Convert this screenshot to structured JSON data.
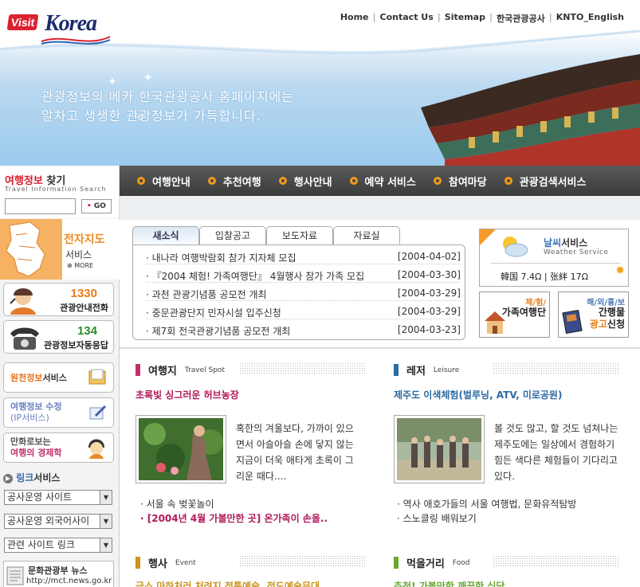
{
  "header": {
    "logo_visit": "Visit",
    "logo_korea": "Korea",
    "top_links": [
      "Home",
      "Contact Us",
      "Sitemap",
      "한국관광공사",
      "KNTO_English"
    ],
    "headline_line1": "관광정보의 메카 한국관광공사 홈페이지에는",
    "headline_line2": "알차고 생생한 관광정보가 가득합니다."
  },
  "nav": {
    "items": [
      "여행안내",
      "추천여행",
      "행사안내",
      "예약 서비스",
      "참여마당",
      "관광검색서비스"
    ]
  },
  "search": {
    "title_red": "여행정보",
    "title_black": " 찾기",
    "subtitle": "Travel Information Search",
    "input_value": "",
    "go_label": "GO"
  },
  "sidebar": {
    "emap_title": "전자지도",
    "emap_sub": "서비스",
    "emap_more": "MORE",
    "phone1_num": "1330",
    "phone1_label": "관광안내전화",
    "phone2_num": "134",
    "phone2_label": "관광정보자동응답",
    "svc1_a": "원천정보",
    "svc1_b": "서비스",
    "svc2_a": "여행정보 수정",
    "svc2_b": "(IP서비스)",
    "svc3_a": "만화로보는",
    "svc3_b": "여행의 경제학",
    "link_title_a": "링크",
    "link_title_b": "서비스",
    "selects": [
      "공사운영 사이트",
      "공사운영 외국어사이",
      "관련 사이트 링크"
    ],
    "mct_title": "문화관광부  뉴스",
    "mct_url": "http://mct.news.go.kr"
  },
  "news": {
    "tabs": [
      "새소식",
      "입찰공고",
      "보도자료",
      "자료실"
    ],
    "rows": [
      {
        "title": "·  내나라 여행박람회 참가 지자체 모집",
        "date": "[2004-04-02]"
      },
      {
        "title": "·  『2004 체험! 가족여행단』 4월행사 참가 가족 모집",
        "date": "[2004-03-30]"
      },
      {
        "title": "·  과천 관광기념품 공모전 개최",
        "date": "[2004-03-29]"
      },
      {
        "title": "·  중문관광단지 민자시설 입주신청",
        "date": "[2004-03-29]"
      },
      {
        "title": "·  제7회 전국관광기념품 공모전 개최",
        "date": "[2004-03-23]"
      }
    ]
  },
  "weather": {
    "title_a": "날씨",
    "title_b": "서비스",
    "subtitle": "Weather Service",
    "reading": "韓国 7.4Ω  | 张絆 17Ω"
  },
  "promos": {
    "family_top": "체/험/",
    "family_main": "가족여행단",
    "ad_top": "해/외/홍/보",
    "ad_main_a": "간행물",
    "ad_main_b_orange": "광고",
    "ad_main_c": "신청"
  },
  "sections": {
    "travel": {
      "title": "여행지",
      "en": "Travel Spot",
      "subtitle": "초록빛 싱그러운 허브농장",
      "text": "혹한의 겨울보다, 가까이 있으면서 아슬아슬 손에 닿지 않는 지금이 더욱 애타게 초록이 그리운 때다....",
      "items": [
        "·  서울 속 벚꽃놀이",
        "·  [2004년 4월 가볼만한 곳] 온가족이 손을.."
      ]
    },
    "leisure": {
      "title": "레저",
      "en": "Leisure",
      "subtitle": "제주도 이색체험(벌루닝, ATV, 미로공원)",
      "text": "볼 것도 많고, 할 것도 넘쳐나는 제주도에는 일상에서 경험하기 힘든 색다른 체험들이 기다리고 있다.",
      "items": [
        "·  역사 애호가들의 서울 여행법, 문화유적탐방",
        "·  스노클링 배워보기"
      ]
    },
    "event": {
      "title": "행사",
      "en": "Event",
      "subtitle": "금소 마하처러 처려지 전통예술, 전도예술무대"
    },
    "food": {
      "title": "먹을거리",
      "en": "Food",
      "subtitle": "추천! 가볼만한 깨끗한 식당"
    }
  },
  "colors": {
    "nav_bg": "#444444",
    "nav_bullet": "#f39a1a",
    "brand_red": "#d6202f",
    "travel_bar": "#c0306e",
    "leisure_bar": "#2d6aa3",
    "event_bar": "#c8951a",
    "food_bar": "#6aa832"
  }
}
